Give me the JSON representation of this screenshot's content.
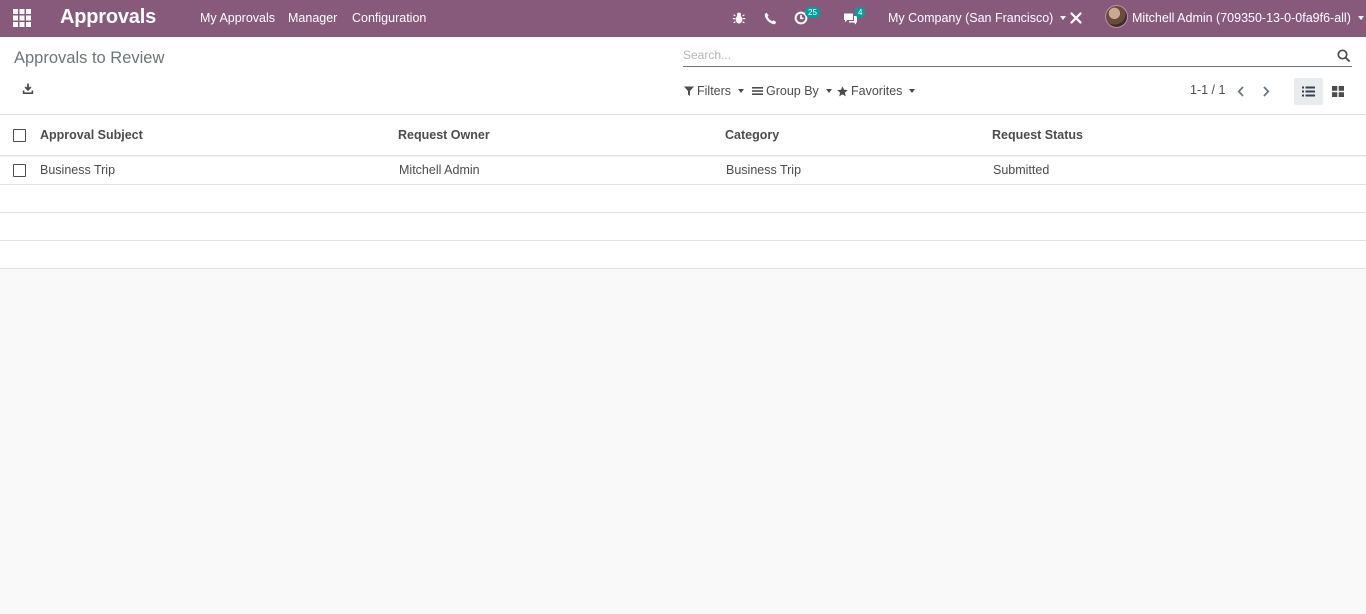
{
  "navbar": {
    "app_title": "Approvals",
    "menu": [
      "My Approvals",
      "Manager",
      "Configuration"
    ],
    "icons": [
      "apps-grid-icon",
      "bug-icon",
      "phone-icon",
      "activity-clock-icon",
      "chat-icon",
      "close-icon"
    ],
    "activity_count": "25",
    "message_count": "4",
    "company": "My Company (San Francisco)",
    "user": "Mitchell Admin (709350-13-0-0fa9f6-all)",
    "brand_color": "#875a7b",
    "badge_color": "#00a09d"
  },
  "control_panel": {
    "title": "Approvals to Review",
    "search_placeholder": "Search...",
    "filters_label": "Filters",
    "group_by_label": "Group By",
    "favorites_label": "Favorites",
    "pager": "1-1 / 1",
    "views": [
      "list-view-icon",
      "kanban-view-icon"
    ],
    "active_view": "list"
  },
  "table": {
    "columns": [
      "Approval Subject",
      "Request Owner",
      "Category",
      "Request Status"
    ],
    "rows": [
      [
        "Business Trip",
        "Mitchell Admin",
        "Business Trip",
        "Submitted"
      ]
    ]
  }
}
